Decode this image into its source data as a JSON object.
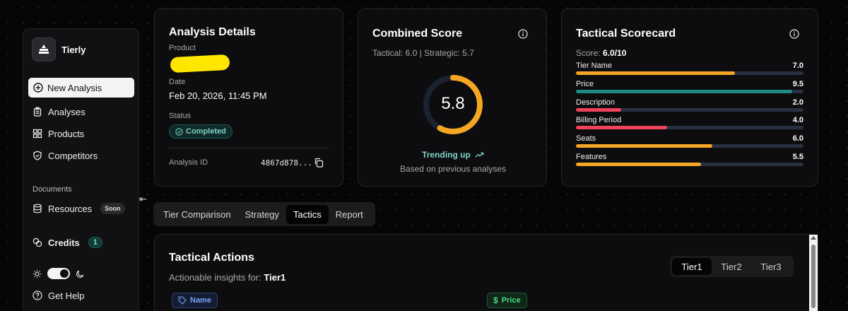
{
  "sidebar": {
    "brand": "Tierly",
    "new_analysis": "New Analysis",
    "items": [
      {
        "label": "Analyses",
        "icon": "clipboard-icon"
      },
      {
        "label": "Products",
        "icon": "grid-icon"
      },
      {
        "label": "Competitors",
        "icon": "shield-icon"
      }
    ],
    "section_documents": "Documents",
    "resources": {
      "label": "Resources",
      "badge": "Soon",
      "icon": "database-icon"
    },
    "credits": {
      "label": "Credits",
      "count": "1",
      "icon": "coins-icon"
    },
    "help": "Get Help"
  },
  "analysis_details": {
    "title": "Analysis Details",
    "product_label": "Product",
    "date_label": "Date",
    "date_value": "Feb 20, 2026, 11:45 PM",
    "status_label": "Status",
    "status_value": "Completed",
    "id_label": "Analysis ID",
    "id_value": "4867d878..."
  },
  "combined_score": {
    "title": "Combined Score",
    "tactical_strategic": "Tactical: 6.0 | Strategic: 5.7",
    "score": "5.8",
    "score_fraction": 0.58,
    "trend": "Trending up",
    "trend_note": "Based on previous analyses",
    "colors": {
      "ring": "#f5a623",
      "ring_track": "#1b2230",
      "trend": "#7dd3c8"
    }
  },
  "tactical_scorecard": {
    "title": "Tactical Scorecard",
    "score_label": "Score:",
    "score_value": "6.0/10",
    "rows": [
      {
        "label": "Tier Name",
        "value": "7.0",
        "fraction": 0.7,
        "color": "#f5a623"
      },
      {
        "label": "Price",
        "value": "9.5",
        "fraction": 0.95,
        "color": "#1f8a84"
      },
      {
        "label": "Description",
        "value": "2.0",
        "fraction": 0.2,
        "color": "#f0435a"
      },
      {
        "label": "Billing Period",
        "value": "4.0",
        "fraction": 0.4,
        "color": "#f0435a"
      },
      {
        "label": "Seats",
        "value": "6.0",
        "fraction": 0.6,
        "color": "#f5a623"
      },
      {
        "label": "Features",
        "value": "5.5",
        "fraction": 0.55,
        "color": "#f5a623"
      }
    ]
  },
  "tabs": [
    "Tier Comparison",
    "Strategy",
    "Tactics",
    "Report"
  ],
  "active_tab": "Tactics",
  "tactical_actions": {
    "title": "Tactical Actions",
    "subtitle_prefix": "Actionable insights for:",
    "subtitle_tier": "Tier1",
    "tiers": [
      "Tier1",
      "Tier2",
      "Tier3"
    ],
    "active_tier": "Tier1",
    "chips": [
      {
        "label": "Name",
        "color": "#7aa2f7"
      },
      {
        "label": "Price",
        "color": "#4ade80"
      }
    ]
  }
}
